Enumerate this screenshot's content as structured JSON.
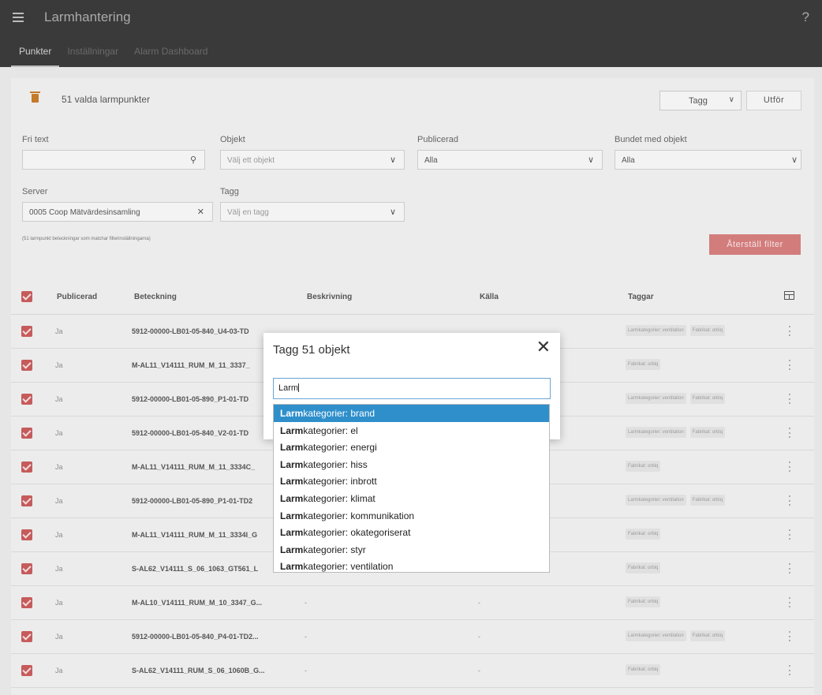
{
  "app": {
    "title": "Larmhantering",
    "help": "?"
  },
  "tabs": [
    "Punkter",
    "Inställningar",
    "Alarm Dashboard"
  ],
  "toolbar": {
    "selected_count": "51 valda larmpunkter",
    "action_select": "Tagg",
    "run_button": "Utför"
  },
  "filters": {
    "fritext": {
      "label": "Fri text",
      "value": ""
    },
    "objekt": {
      "label": "Objekt",
      "placeholder": "Välj ett objekt"
    },
    "publicerad": {
      "label": "Publicerad",
      "value": "Alla"
    },
    "bundet": {
      "label": "Bundet med objekt",
      "value": "Alla"
    },
    "server": {
      "label": "Server",
      "value": "0005 Coop Mätvärdesinsamling"
    },
    "tagg": {
      "label": "Tagg",
      "placeholder": "Välj en tagg"
    },
    "match_text": "(51 larmpunkt beteckningar som matchar filterinställningarna)",
    "reset_button": "Återställ filter"
  },
  "table": {
    "headers": {
      "publicerad": "Publicerad",
      "beteckning": "Beteckning",
      "beskrivning": "Beskrivning",
      "kalla": "Källa",
      "taggar": "Taggar"
    },
    "rows": [
      {
        "pub": "Ja",
        "bet": "5912-00000-LB01-05-840_U4-03-TD",
        "desc": "",
        "src": "",
        "tags": [
          "Larmkategorier: ventilation",
          "Fabrikat: orbiq"
        ]
      },
      {
        "pub": "Ja",
        "bet": "M-AL11_V14111_RUM_M_11_3337_",
        "desc": "",
        "src": "",
        "tags": [
          "Fabrikat: orbiq"
        ]
      },
      {
        "pub": "Ja",
        "bet": "5912-00000-LB01-05-890_P1-01-TD",
        "desc": "",
        "src": "",
        "tags": [
          "Larmkategorier: ventilation",
          "Fabrikat: orbiq"
        ]
      },
      {
        "pub": "Ja",
        "bet": "5912-00000-LB01-05-840_V2-01-TD",
        "desc": "",
        "src": "",
        "tags": [
          "Larmkategorier: ventilation",
          "Fabrikat: orbiq"
        ]
      },
      {
        "pub": "Ja",
        "bet": "M-AL11_V14111_RUM_M_11_3334C_",
        "desc": "",
        "src": "",
        "tags": [
          "Fabrikat: orbiq"
        ]
      },
      {
        "pub": "Ja",
        "bet": "5912-00000-LB01-05-890_P1-01-TD2",
        "desc": "",
        "src": "",
        "tags": [
          "Larmkategorier: ventilation",
          "Fabrikat: orbiq"
        ]
      },
      {
        "pub": "Ja",
        "bet": "M-AL11_V14111_RUM_M_11_3334I_G",
        "desc": "",
        "src": "",
        "tags": [
          "Fabrikat: orbiq"
        ]
      },
      {
        "pub": "Ja",
        "bet": "S-AL62_V14111_S_06_1063_GT561_L",
        "desc": "",
        "src": "",
        "tags": [
          "Fabrikat: orbiq"
        ]
      },
      {
        "pub": "Ja",
        "bet": "M-AL10_V14111_RUM_M_10_3347_G...",
        "desc": "-",
        "src": "-",
        "tags": [
          "Fabrikat: orbiq"
        ]
      },
      {
        "pub": "Ja",
        "bet": "5912-00000-LB01-05-840_P4-01-TD2...",
        "desc": "-",
        "src": "-",
        "tags": [
          "Larmkategorier: ventilation",
          "Fabrikat: orbiq"
        ]
      },
      {
        "pub": "Ja",
        "bet": "S-AL62_V14111_RUM_S_06_1060B_G...",
        "desc": "-",
        "src": "-",
        "tags": [
          "Fabrikat: orbiq"
        ]
      }
    ]
  },
  "modal": {
    "title": "Tagg 51 objekt",
    "input_value": "Larm",
    "suggestions": [
      {
        "match": "Larm",
        "rest": "kategorier: brand"
      },
      {
        "match": "Larm",
        "rest": "kategorier: el"
      },
      {
        "match": "Larm",
        "rest": "kategorier: energi"
      },
      {
        "match": "Larm",
        "rest": "kategorier: hiss"
      },
      {
        "match": "Larm",
        "rest": "kategorier: inbrott"
      },
      {
        "match": "Larm",
        "rest": "kategorier: klimat"
      },
      {
        "match": "Larm",
        "rest": "kategorier: kommunikation"
      },
      {
        "match": "Larm",
        "rest": "kategorier: okategoriserat"
      },
      {
        "match": "Larm",
        "rest": "kategorier: styr"
      },
      {
        "match": "Larm",
        "rest": "kategorier: ventilation"
      }
    ]
  },
  "colors": {
    "header": "#3a3a3a",
    "accent_red": "#c65b5b",
    "highlight_blue": "#2f8fcb",
    "trash": "#c57a2b"
  }
}
